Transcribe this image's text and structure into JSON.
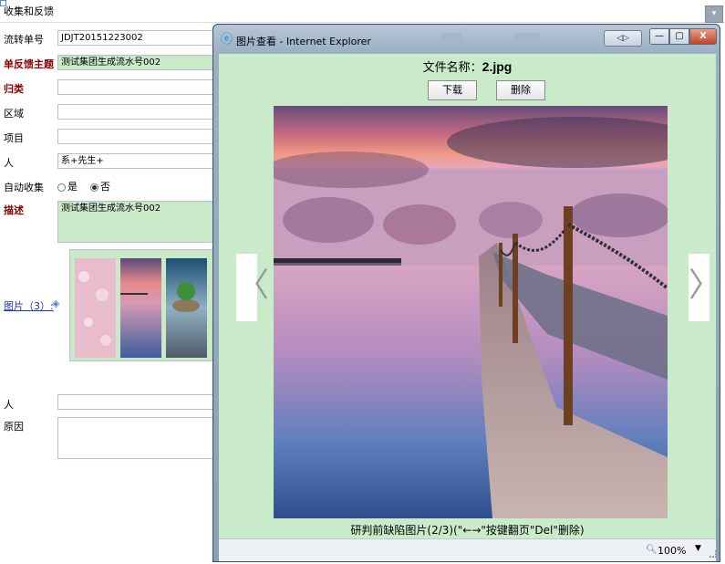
{
  "form": {
    "title": "收集和反馈",
    "rows": [
      {
        "label": "流转单号",
        "value": "JDJT20151223002"
      },
      {
        "label": "单反馈主题",
        "value": "测试集团生成流水号002"
      },
      {
        "label": "归类",
        "value": ""
      },
      {
        "label": "区域",
        "value": ""
      },
      {
        "label": "项目",
        "value": ""
      },
      {
        "label": "人",
        "value": "系+先生+"
      },
      {
        "label": "自动收集",
        "value": ""
      },
      {
        "label": "描述",
        "value": "测试集团生成流水号002"
      },
      {
        "label": "人",
        "value": ""
      },
      {
        "label": "原因",
        "value": ""
      }
    ],
    "radio_yes": "是",
    "radio_no": "否",
    "images_link": "图片（3）:"
  },
  "popup": {
    "window_title": "图片查看 - Internet Explorer",
    "file_name_label": "文件名称：",
    "file_name": "2.jpg",
    "download_button": "下载",
    "delete_button": "删除",
    "prev_arrow": "〈",
    "next_arrow": "〉",
    "caption": "研判前缺陷图片(2/3)(\"←→\"按键翻页\"Del\"删除)",
    "zoom": "100%",
    "minimize": "—",
    "maximize": "▢",
    "close": "X"
  },
  "colors": {
    "content_green": "#c9ebc9",
    "label_red": "#8b0000",
    "link_blue": "#2233bb"
  }
}
